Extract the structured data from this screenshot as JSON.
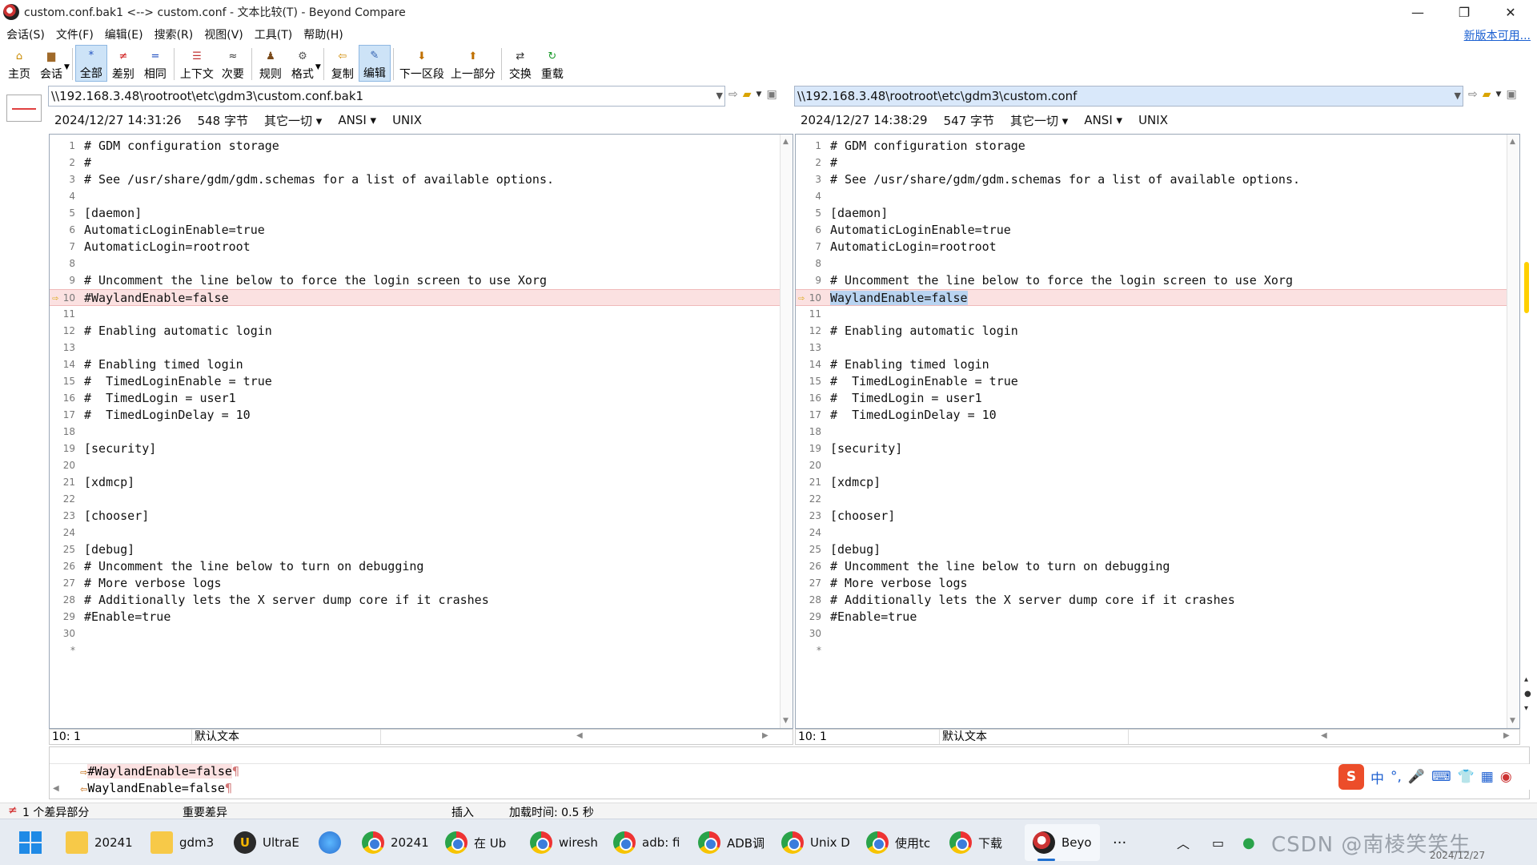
{
  "window": {
    "title": "custom.conf.bak1 <--> custom.conf - 文本比较(T) - Beyond Compare",
    "minimize": "—",
    "maximize": "❐",
    "close": "✕"
  },
  "menu": {
    "items": [
      "会话(S)",
      "文件(F)",
      "编辑(E)",
      "搜索(R)",
      "视图(V)",
      "工具(T)",
      "帮助(H)"
    ],
    "new_version": "新版本可用..."
  },
  "toolbar": {
    "home": "主页",
    "session": "会话",
    "all": "全部",
    "diffs": "差别",
    "same": "相同",
    "context": "上下文",
    "minor": "次要",
    "rules": "规则",
    "format": "格式",
    "copy": "复制",
    "edit": "编辑",
    "next_section": "下一区段",
    "prev_section": "上一部分",
    "swap": "交换",
    "reload": "重载"
  },
  "left": {
    "path": "\\\\192.168.3.48\\rootroot\\etc\\gdm3\\custom.conf.bak1",
    "timestamp": "2024/12/27 14:31:26",
    "size": "548 字节",
    "other": "其它一切",
    "encoding": "ANSI",
    "lineend": "UNIX",
    "position": "10: 1",
    "text_format": "默认文本"
  },
  "right": {
    "path": "\\\\192.168.3.48\\rootroot\\etc\\gdm3\\custom.conf",
    "timestamp": "2024/12/27 14:38:29",
    "size": "547 字节",
    "other": "其它一切",
    "encoding": "ANSI",
    "lineend": "UNIX",
    "position": "10: 1",
    "text_format": "默认文本"
  },
  "lines": [
    {
      "n": "1",
      "l": "# GDM configuration storage",
      "r": "# GDM configuration storage"
    },
    {
      "n": "2",
      "l": "#",
      "r": "#"
    },
    {
      "n": "3",
      "l": "# See /usr/share/gdm/gdm.schemas for a list of available options.",
      "r": "# See /usr/share/gdm/gdm.schemas for a list of available options."
    },
    {
      "n": "4",
      "l": "",
      "r": ""
    },
    {
      "n": "5",
      "l": "[daemon]",
      "r": "[daemon]"
    },
    {
      "n": "6",
      "l": "AutomaticLoginEnable=true",
      "r": "AutomaticLoginEnable=true"
    },
    {
      "n": "7",
      "l": "AutomaticLogin=rootroot",
      "r": "AutomaticLogin=rootroot"
    },
    {
      "n": "8",
      "l": "",
      "r": ""
    },
    {
      "n": "9",
      "l": "# Uncomment the line below to force the login screen to use Xorg",
      "r": "# Uncomment the line below to force the login screen to use Xorg"
    },
    {
      "n": "10",
      "l": "#WaylandEnable=false",
      "r": "WaylandEnable=false",
      "diff": true
    },
    {
      "n": "11",
      "l": "",
      "r": ""
    },
    {
      "n": "12",
      "l": "# Enabling automatic login",
      "r": "# Enabling automatic login"
    },
    {
      "n": "13",
      "l": "",
      "r": ""
    },
    {
      "n": "14",
      "l": "# Enabling timed login",
      "r": "# Enabling timed login"
    },
    {
      "n": "15",
      "l": "#  TimedLoginEnable = true",
      "r": "#  TimedLoginEnable = true"
    },
    {
      "n": "16",
      "l": "#  TimedLogin = user1",
      "r": "#  TimedLogin = user1"
    },
    {
      "n": "17",
      "l": "#  TimedLoginDelay = 10",
      "r": "#  TimedLoginDelay = 10"
    },
    {
      "n": "18",
      "l": "",
      "r": ""
    },
    {
      "n": "19",
      "l": "[security]",
      "r": "[security]"
    },
    {
      "n": "20",
      "l": "",
      "r": ""
    },
    {
      "n": "21",
      "l": "[xdmcp]",
      "r": "[xdmcp]"
    },
    {
      "n": "22",
      "l": "",
      "r": ""
    },
    {
      "n": "23",
      "l": "[chooser]",
      "r": "[chooser]"
    },
    {
      "n": "24",
      "l": "",
      "r": ""
    },
    {
      "n": "25",
      "l": "[debug]",
      "r": "[debug]"
    },
    {
      "n": "26",
      "l": "# Uncomment the line below to turn on debugging",
      "r": "# Uncomment the line below to turn on debugging"
    },
    {
      "n": "27",
      "l": "# More verbose logs",
      "r": "# More verbose logs"
    },
    {
      "n": "28",
      "l": "# Additionally lets the X server dump core if it crashes",
      "r": "# Additionally lets the X server dump core if it crashes"
    },
    {
      "n": "29",
      "l": "#Enable=true",
      "r": "#Enable=true"
    },
    {
      "n": "30",
      "l": "",
      "r": ""
    }
  ],
  "end_marker": "*",
  "compare": {
    "top": "#WaylandEnable=false",
    "bottom": "WaylandEnable=false",
    "pilcrow": "¶"
  },
  "status": {
    "diff_count": "1 个差异部分",
    "important": "重要差异",
    "insert": "插入",
    "load_time": "加载时间: 0.5 秒"
  },
  "ime": {
    "lang": "中",
    "punct": "°,"
  },
  "taskbar": {
    "items": [
      "20241",
      "gdm3",
      "UltraE",
      "",
      "20241",
      "在 Ub",
      "wiresh",
      "adb: fi",
      "ADB调",
      "Unix D",
      "使用tc",
      "下载",
      "Beyo"
    ],
    "more": "···",
    "watermark": "CSDN @南棱笑笑生",
    "date": "2024/12/27"
  },
  "colors": {
    "diff_bg": "#fbe1e1",
    "accent": "#1a5fd1",
    "selection": "#b9d4f1"
  }
}
